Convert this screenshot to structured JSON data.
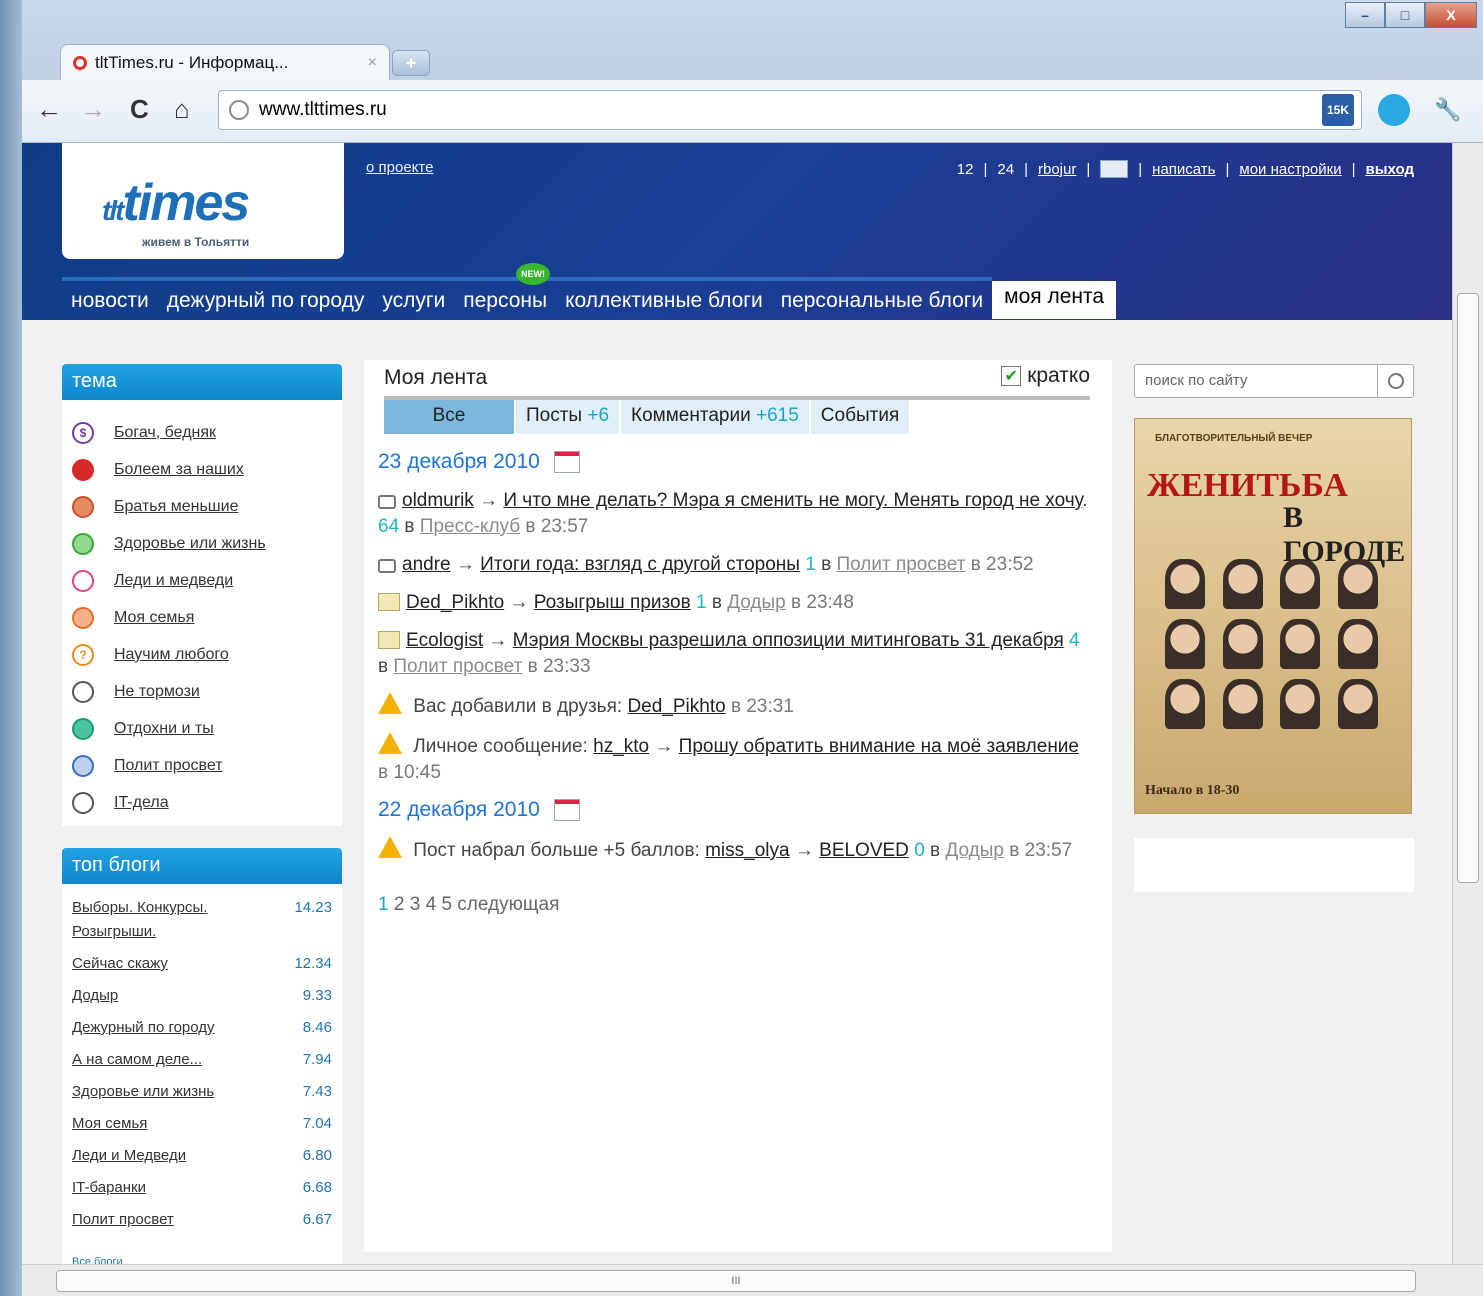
{
  "browser": {
    "tab_title": "tltTimes.ru - Информац...",
    "tab_close": "×",
    "new_tab": "+",
    "url": "www.tlttimes.ru",
    "ext_badge": "15K",
    "window_buttons": [
      "–",
      "□",
      "X"
    ],
    "nav": {
      "back": "←",
      "forward": "→",
      "reload": "C",
      "home": "⌂"
    },
    "star": "☆",
    "wrench": "🔧",
    "h_scroll_grip": "III"
  },
  "site": {
    "logo_main": "times",
    "logo_prefix": "tlt",
    "logo_sub": "живем в Тольятти",
    "about": "о проекте",
    "top_links": {
      "n1": "12",
      "n2": "24",
      "user": "rbojur",
      "write": "написать",
      "settings": "мои настройки",
      "logout": "выход",
      "sep": "|"
    },
    "nav": [
      "новости",
      "дежурный по городу",
      "услуги",
      "персоны",
      "коллективные блоги",
      "персональные блоги",
      "моя лента"
    ],
    "new_badge": "NEW!"
  },
  "sidebar": {
    "theme_title": "тема",
    "themes": [
      {
        "label": "Богач, бедняк",
        "icon": "dollar-icon",
        "color": "#6c3f9e"
      },
      {
        "label": "Болеем за наших",
        "icon": "ball-icon",
        "color": "#d62a2a"
      },
      {
        "label": "Братья меньшие",
        "icon": "paw-icon",
        "color": "#c8502a"
      },
      {
        "label": "Здоровье или жизнь",
        "icon": "health-icon",
        "color": "#3aa33a"
      },
      {
        "label": "Леди и медведи",
        "icon": "heart-icon",
        "color": "#e0457a"
      },
      {
        "label": "Моя семья",
        "icon": "family-icon",
        "color": "#e66a2a"
      },
      {
        "label": "Научим любого",
        "icon": "question-icon",
        "color": "#ee8a16"
      },
      {
        "label": "Не тормози",
        "icon": "car-icon",
        "color": "#555555"
      },
      {
        "label": "Отдохни и ты",
        "icon": "leisure-icon",
        "color": "#1e9a76"
      },
      {
        "label": "Полит просвет",
        "icon": "politics-icon",
        "color": "#3a6bc0"
      },
      {
        "label": "IT-дела",
        "icon": "it-icon",
        "color": "#555555"
      }
    ],
    "top_title": "топ блоги",
    "top_blogs": [
      {
        "name": "Выборы. Конкурсы. Розыгрыши.",
        "score": "14.23"
      },
      {
        "name": "Сейчас скажу",
        "score": "12.34"
      },
      {
        "name": "Додыр",
        "score": "9.33"
      },
      {
        "name": "Дежурный по городу",
        "score": "8.46"
      },
      {
        "name": "А на самом деле...",
        "score": "7.94"
      },
      {
        "name": "Здоровье или жизнь",
        "score": "7.43"
      },
      {
        "name": "Моя семья",
        "score": "7.04"
      },
      {
        "name": "Леди и Медведи",
        "score": "6.80"
      },
      {
        "name": "IT-баранки",
        "score": "6.68"
      },
      {
        "name": "Полит просвет",
        "score": "6.67"
      }
    ],
    "all_blogs": "Все блоги"
  },
  "feed": {
    "title": "Моя лента",
    "brief_label": "кратко",
    "brief_check": "✔",
    "tabs": [
      {
        "label": "Все",
        "count": ""
      },
      {
        "label": "Посты",
        "count": "+6"
      },
      {
        "label": "Комментарии",
        "count": "+615"
      },
      {
        "label": "События",
        "count": ""
      }
    ],
    "days": [
      {
        "date": "23 декабря 2010",
        "entries": [
          {
            "type": "comment",
            "user": "oldmurik",
            "arrow": "→",
            "title": "И что мне делать? Мэра я сменить не могу. Менять город не хочу",
            "tail": ".",
            "count": "64",
            "in": "в",
            "blog": "Пресс-клуб",
            "time": "в 23:57"
          },
          {
            "type": "comment",
            "user": "andre",
            "arrow": "→",
            "title": "Итоги года: взгляд с другой стороны",
            "tail": "",
            "count": "1",
            "in": "в",
            "blog": "Полит просвет",
            "time": "в 23:52"
          },
          {
            "type": "post",
            "user": "Ded_Pikhto",
            "arrow": "→",
            "title": "Розыгрыш призов",
            "tail": "",
            "count": "1",
            "in": "в",
            "blog": "Додыр",
            "time": "в 23:48"
          },
          {
            "type": "post",
            "user": "Ecologist",
            "arrow": "→",
            "title": "Мэрия Москвы разрешила оппозиции митинговать 31 декабря",
            "tail": "",
            "count": "4",
            "in": "в",
            "blog": "Полит просвет",
            "time": "в 23:33"
          }
        ],
        "events": [
          {
            "text": "Вас добавили в друзья:",
            "user": "Ded_Pikhto",
            "time": "в 23:31"
          },
          {
            "text": "Личное сообщение:",
            "user": "hz_kto",
            "arrow": "→",
            "title": "Прошу обратить внимание на моё заявление",
            "time": "в 10:45"
          }
        ]
      },
      {
        "date": "22 декабря 2010",
        "event": {
          "text": "Пост набрал больше +5 баллов:",
          "user": "miss_olya",
          "arrow": "→",
          "title": "BELOVED",
          "count": "0",
          "in": "в",
          "blog": "Додыр",
          "time": "в 23:57"
        }
      }
    ],
    "pager": {
      "current": "1",
      "pages": [
        "2",
        "3",
        "4",
        "5"
      ],
      "next": "следующая"
    }
  },
  "right": {
    "search_placeholder": "поиск по сайту",
    "poster": {
      "top": "БЛАГОТВОРИТЕЛЬНЫЙ ВЕЧЕР",
      "title": "ЖЕНИТЬБА",
      "sub": "В ГОРОДЕ Т",
      "bottom": "Начало в 18-30"
    }
  }
}
